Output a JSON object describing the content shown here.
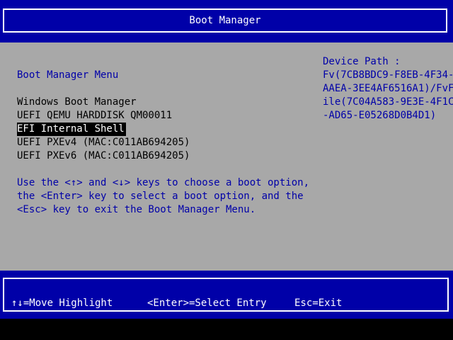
{
  "header": {
    "title": "Boot Manager"
  },
  "menu": {
    "heading": "Boot Manager Menu",
    "items": [
      {
        "label": "Windows Boot Manager",
        "selected": false
      },
      {
        "label": "UEFI QEMU HARDDISK QM00011",
        "selected": false
      },
      {
        "label": "EFI Internal Shell",
        "selected": true
      },
      {
        "label": "UEFI PXEv4 (MAC:C011AB694205)",
        "selected": false
      },
      {
        "label": "UEFI PXEv6 (MAC:C011AB694205)",
        "selected": false
      }
    ]
  },
  "help": {
    "lines": [
      "Use the <↑> and <↓> keys to choose a boot option,",
      "the <Enter> key to select a boot option, and the",
      "<Esc> key to exit the Boot Manager Menu."
    ]
  },
  "device_path": {
    "label": "Device Path :",
    "lines": [
      "Fv(7CB8BDC9-F8EB-4F34-",
      "AAEA-3EE4AF6516A1)/FvF",
      "ile(7C04A583-9E3E-4F1C",
      "-AD65-E05268D0B4D1)"
    ]
  },
  "footer": {
    "move": "↑↓=Move Highlight",
    "select": "<Enter>=Select Entry",
    "exit": "Esc=Exit"
  },
  "colors": {
    "background": "#a8a8a8",
    "band": "#0000a8",
    "text_blue": "#0000a8",
    "text_white": "#ffffff",
    "highlight_bg": "#000000"
  }
}
